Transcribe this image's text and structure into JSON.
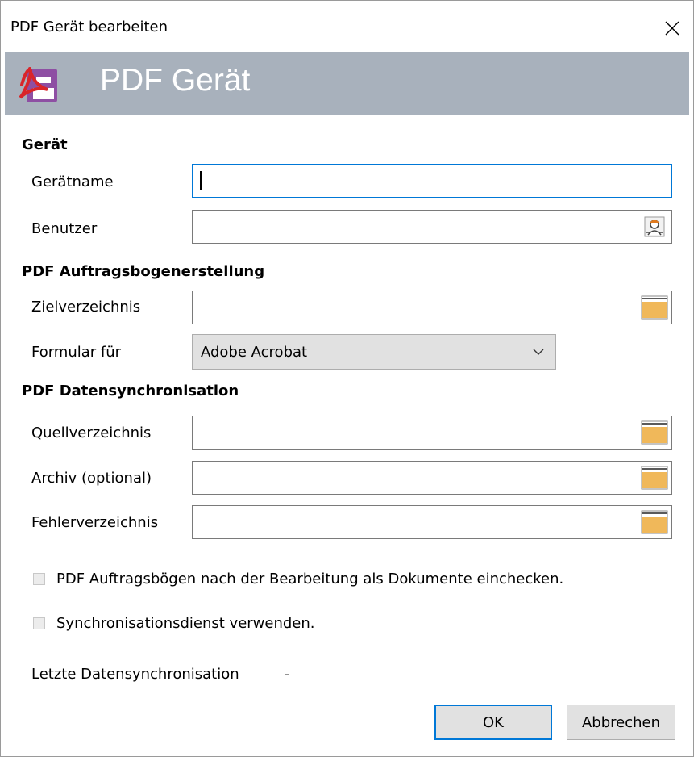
{
  "window": {
    "title": "PDF Gerät bearbeiten",
    "close_glyph": "✕"
  },
  "banner": {
    "title": "PDF Gerät",
    "icon": "pdf-save-icon"
  },
  "sections": {
    "device": "Gerät",
    "order_form": "PDF Auftragsbogenerstellung",
    "sync": "PDF Datensynchronisation"
  },
  "fields": {
    "device_name": {
      "label": "Gerätname",
      "value": ""
    },
    "user": {
      "label": "Benutzer",
      "value": ""
    },
    "target_dir": {
      "label": "Zielverzeichnis",
      "value": ""
    },
    "form_for": {
      "label": "Formular für",
      "value": "Adobe Acrobat"
    },
    "source_dir": {
      "label": "Quellverzeichnis",
      "value": ""
    },
    "archive": {
      "label": "Archiv (optional)",
      "value": ""
    },
    "error_dir": {
      "label": "Fehlerverzeichnis",
      "value": ""
    }
  },
  "checkboxes": {
    "checkin": {
      "label": "PDF Auftragsbögen nach der Bearbeitung als Dokumente einchecken.",
      "checked": false
    },
    "sync_service": {
      "label": "Synchronisationsdienst verwenden.",
      "checked": false
    }
  },
  "status": {
    "label": "Letzte Datensynchronisation",
    "value": "-"
  },
  "buttons": {
    "ok": "OK",
    "cancel": "Abbrechen"
  },
  "colors": {
    "banner": "#a8b1bc",
    "accent": "#0078d7",
    "pdf_red": "#d9252a",
    "pdf_purple": "#8e4fa3",
    "folder": "#f0b85a"
  }
}
